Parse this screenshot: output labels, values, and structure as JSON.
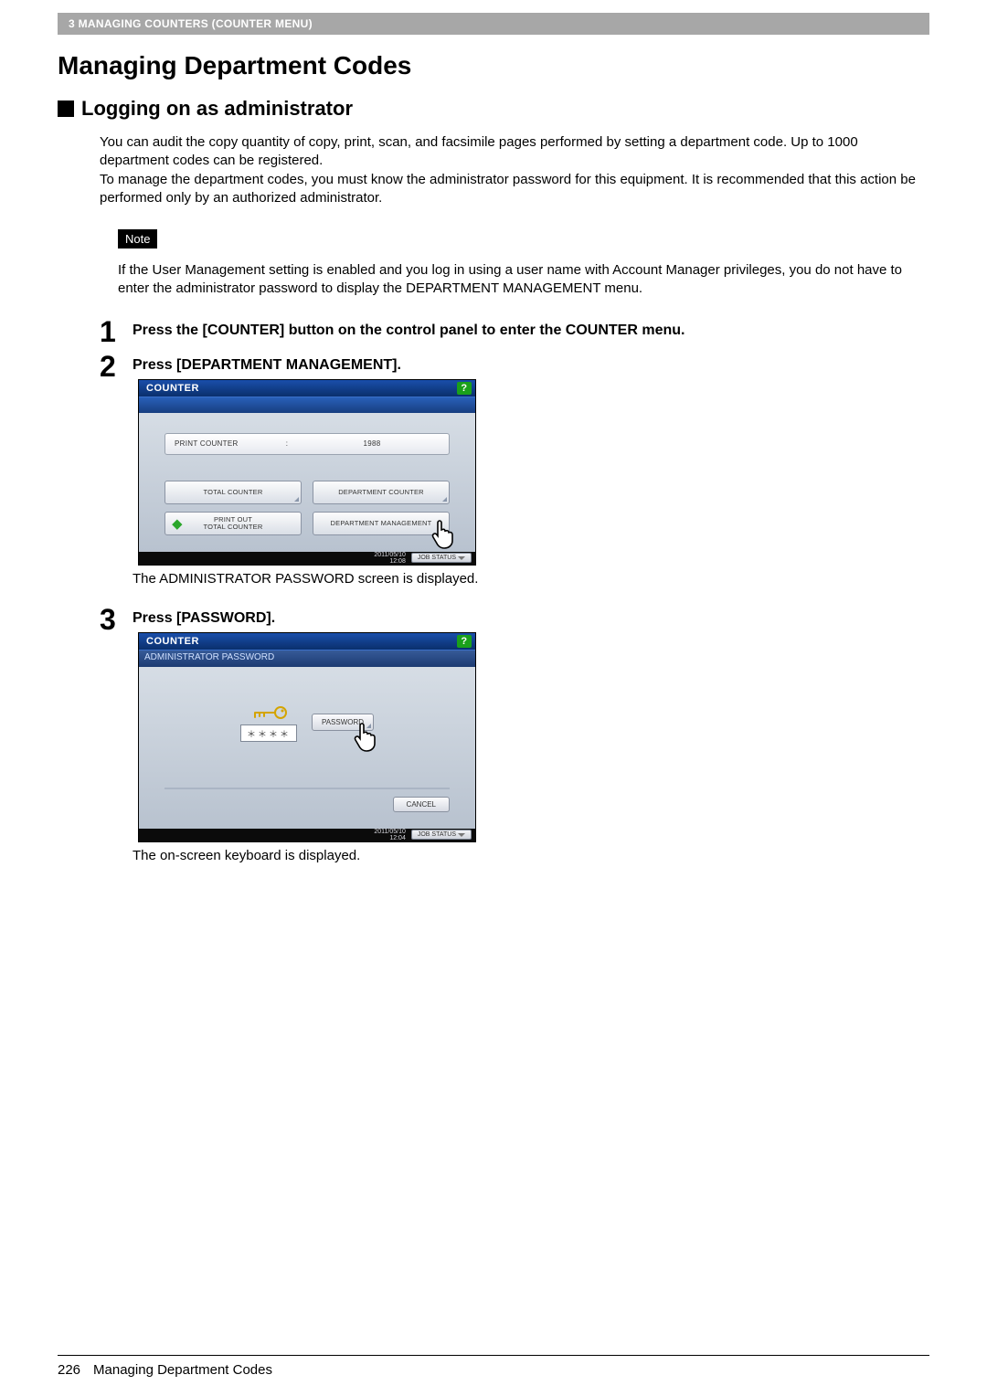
{
  "header": {
    "breadcrumb": "3 MANAGING COUNTERS (COUNTER MENU)"
  },
  "title": "Managing Department Codes",
  "section_heading": "Logging on as administrator",
  "intro_p1": "You can audit the copy quantity of copy, print, scan, and facsimile pages performed by setting a department code. Up to 1000 department codes can be registered.",
  "intro_p2": "To manage the department codes, you must know the administrator password for this equipment. It is recommended that this action be performed only by an authorized administrator.",
  "note_label": "Note",
  "note_text": "If the User Management setting is enabled and you log in using a user name with Account Manager privileges, you do not have to enter the administrator password to display the DEPARTMENT MANAGEMENT menu.",
  "steps": [
    {
      "num": "1",
      "title": "Press the [COUNTER] button on the control panel to enter the COUNTER menu."
    },
    {
      "num": "2",
      "title": "Press [DEPARTMENT MANAGEMENT].",
      "caption_after": "The ADMINISTRATOR PASSWORD screen is displayed."
    },
    {
      "num": "3",
      "title": "Press [PASSWORD].",
      "caption_after": "The on-screen keyboard is displayed."
    }
  ],
  "screen1": {
    "title": "COUNTER",
    "help": "?",
    "field_label": "PRINT COUNTER",
    "field_value": "1988",
    "buttons": {
      "total_counter": "TOTAL COUNTER",
      "department_counter": "DEPARTMENT COUNTER",
      "print_out_total": "PRINT OUT\nTOTAL COUNTER",
      "department_management": "DEPARTMENT MANAGEMENT"
    },
    "date": "2011/05/10",
    "time": "12:08",
    "job_status": "JOB STATUS"
  },
  "screen2": {
    "title": "COUNTER",
    "subtitle": "ADMINISTRATOR PASSWORD",
    "help": "?",
    "password_masked": "＊＊＊＊",
    "password_btn": "PASSWORD",
    "cancel_btn": "CANCEL",
    "date": "2011/05/10",
    "time": "12:04",
    "job_status": "JOB STATUS"
  },
  "footer": {
    "page_number": "226",
    "title": "Managing Department Codes"
  }
}
